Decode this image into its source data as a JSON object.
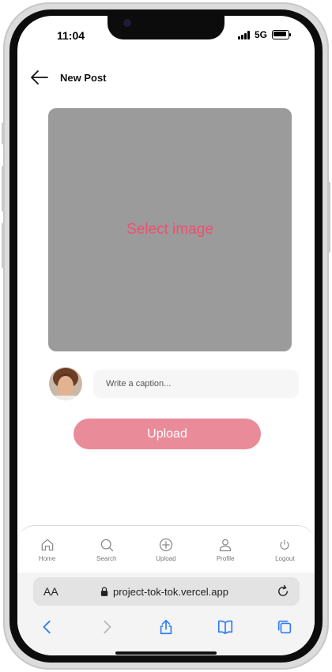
{
  "status": {
    "time": "11:04",
    "network": "5G"
  },
  "header": {
    "title": "New Post"
  },
  "image_picker": {
    "label": "Select image"
  },
  "caption": {
    "placeholder": "Write a caption..."
  },
  "upload": {
    "label": "Upload"
  },
  "tabs": [
    {
      "label": "Home",
      "icon": "home-icon"
    },
    {
      "label": "Search",
      "icon": "search-icon"
    },
    {
      "label": "Upload",
      "icon": "plus-circle-icon"
    },
    {
      "label": "Profile",
      "icon": "user-icon"
    },
    {
      "label": "Logout",
      "icon": "power-icon"
    }
  ],
  "safari": {
    "text_size": "AA",
    "url": "project-tok-tok.vercel.app"
  },
  "colors": {
    "accent": "#ef4f6f",
    "button": "#ea8b99",
    "picker_bg": "#9b9b9b",
    "safari_blue": "#2e7cf6"
  }
}
